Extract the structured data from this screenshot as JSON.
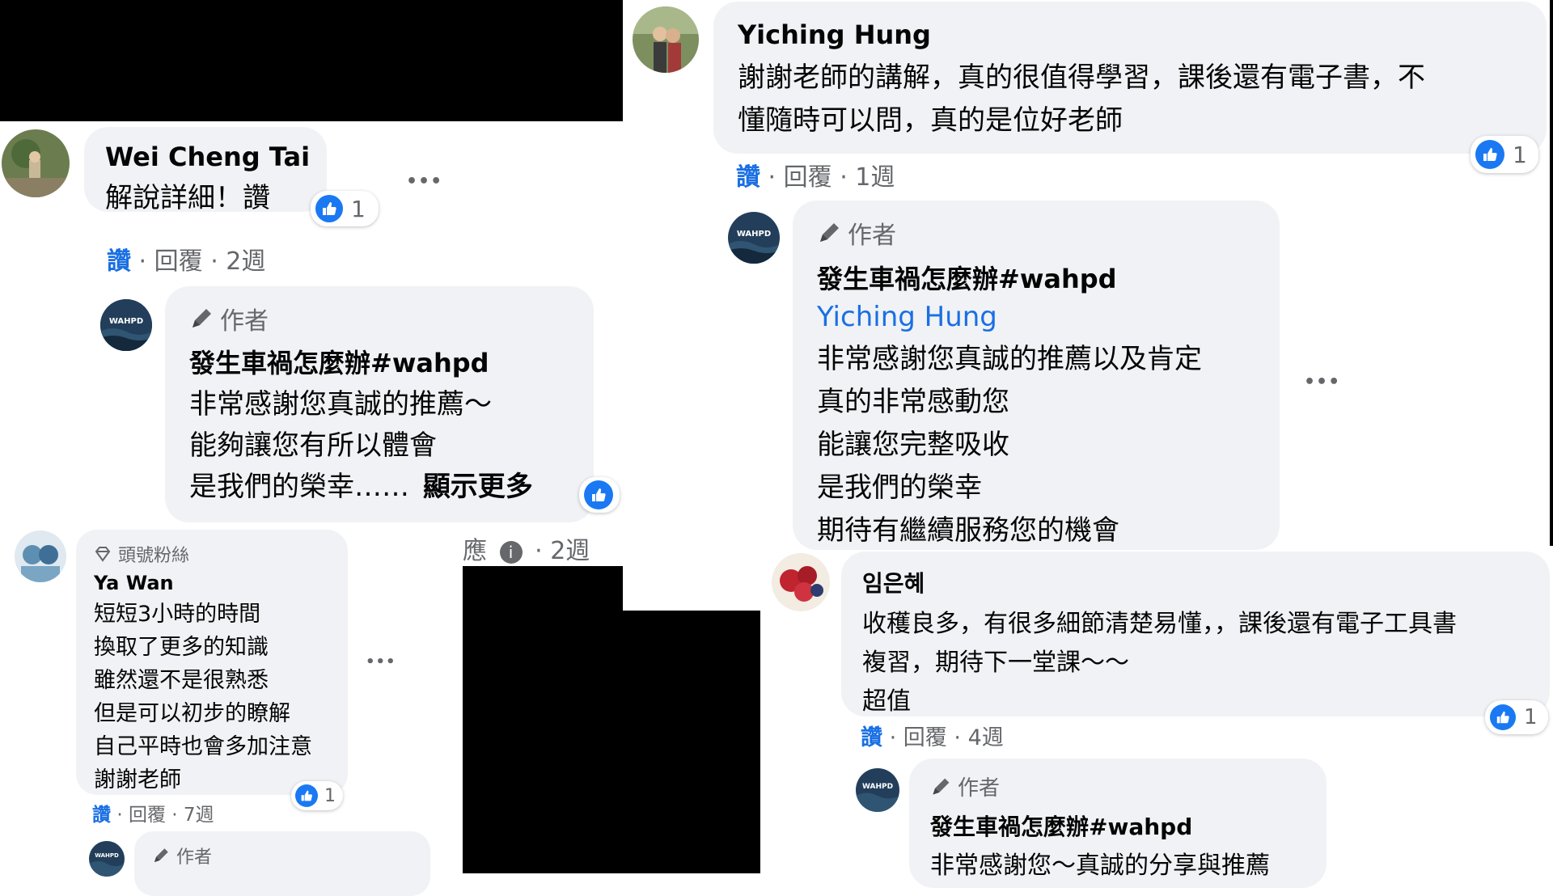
{
  "comments": [
    {
      "name": "Wei Cheng Tai",
      "lines": [
        "解說詳細！讚"
      ],
      "reaction_count": "1",
      "actions": {
        "like": "讚",
        "reply": "回覆",
        "time": "2週"
      },
      "more": "•••",
      "reply": {
        "author_badge": "作者",
        "page_name": "發生車禍怎麼辦#wahpd",
        "lines": [
          "非常感謝您真誠的推薦～",
          "能夠讓您有所以體會",
          "是我們的榮幸……"
        ],
        "see_more": "顯示更多",
        "actions_partial": "應",
        "time": "2週"
      }
    },
    {
      "badge": "頭號粉絲",
      "name": "Ya Wan",
      "lines": [
        "短短3小時的時間",
        "換取了更多的知識",
        "雖然還不是很熟悉",
        "但是可以初步的瞭解",
        "自己平時也會多加注意",
        "謝謝老師"
      ],
      "reaction_count": "1",
      "actions": {
        "like": "讚",
        "reply": "回覆",
        "time": "7週"
      },
      "more": "•••",
      "reply": {
        "author_badge": "作者"
      }
    },
    {
      "name": "Yiching Hung",
      "lines": [
        "謝謝老師的講解，真的很值得學習，課後還有電子書，不",
        "懂隨時可以問，真的是位好老師"
      ],
      "reaction_count": "1",
      "actions": {
        "like": "讚",
        "reply": "回覆",
        "time": "1週"
      },
      "reply": {
        "author_badge": "作者",
        "page_name": "發生車禍怎麼辦#wahpd",
        "mention": "Yiching Hung",
        "lines": [
          "非常感謝您真誠的推薦以及肯定",
          "真的非常感動您",
          "能讓您完整吸收",
          "是我們的榮幸",
          "期待有繼續服務您的機會"
        ],
        "more": "•••"
      }
    },
    {
      "name": "임은혜",
      "lines": [
        "收穫良多，有很多細節清楚易懂，，課後還有電子工具書",
        "複習，期待下一堂課～～",
        "超值"
      ],
      "reaction_count": "1",
      "actions": {
        "like": "讚",
        "reply": "回覆",
        "time": "4週"
      },
      "reply": {
        "author_badge": "作者",
        "page_name": "發生車禍怎麼辦#wahpd",
        "lines": [
          "非常感謝您～真誠的分享與推薦"
        ]
      }
    }
  ],
  "page_avatar_text": "WAHPD",
  "separator": "·",
  "colors": {
    "bubble": "#f0f2f5",
    "link": "#1a6fe3",
    "like_blue": "#1a79f2",
    "meta": "#65676b"
  }
}
